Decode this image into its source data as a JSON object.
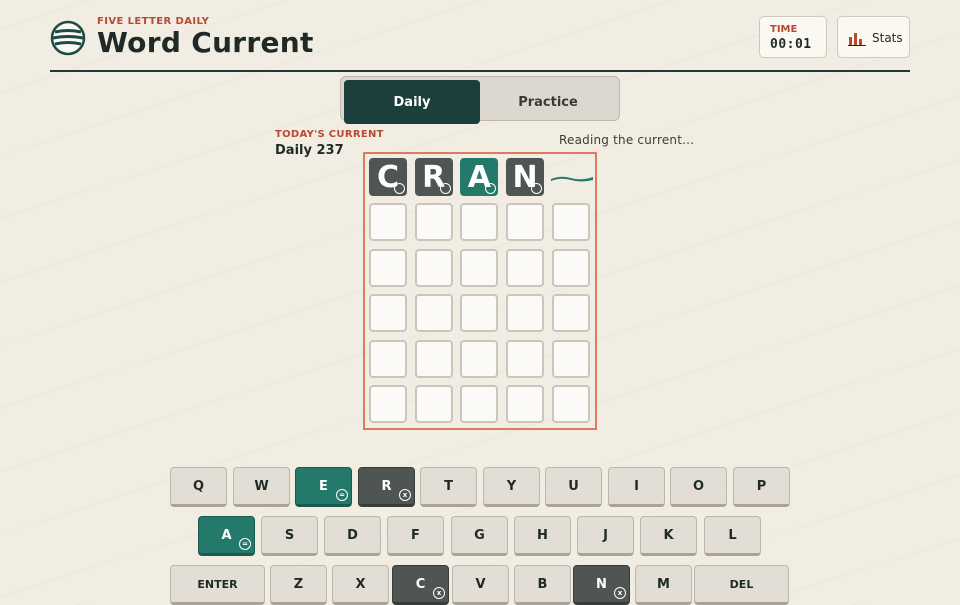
{
  "header": {
    "kicker": "FIVE LETTER DAILY",
    "title": "Word Current",
    "logo_icon": "wave-logo-icon",
    "timer_label": "TIME",
    "timer_value": "00:01",
    "stats_label": "Stats",
    "stats_icon": "bar-chart-icon"
  },
  "mode": {
    "daily": "Daily",
    "practice": "Practice",
    "selected": "Daily"
  },
  "puzzle": {
    "kicker": "TODAY'S CURRENT",
    "name": "Daily 237"
  },
  "status": "Reading the current...",
  "board": {
    "rows": [
      [
        {
          "letter": "C",
          "state": "absent"
        },
        {
          "letter": "R",
          "state": "absent"
        },
        {
          "letter": "A",
          "state": "present"
        },
        {
          "letter": "N",
          "state": "absent"
        },
        {
          "letter": "",
          "state": "typing"
        }
      ],
      [
        {
          "letter": "",
          "state": "empty"
        },
        {
          "letter": "",
          "state": "empty"
        },
        {
          "letter": "",
          "state": "empty"
        },
        {
          "letter": "",
          "state": "empty"
        },
        {
          "letter": "",
          "state": "empty"
        }
      ],
      [
        {
          "letter": "",
          "state": "empty"
        },
        {
          "letter": "",
          "state": "empty"
        },
        {
          "letter": "",
          "state": "empty"
        },
        {
          "letter": "",
          "state": "empty"
        },
        {
          "letter": "",
          "state": "empty"
        }
      ],
      [
        {
          "letter": "",
          "state": "empty"
        },
        {
          "letter": "",
          "state": "empty"
        },
        {
          "letter": "",
          "state": "empty"
        },
        {
          "letter": "",
          "state": "empty"
        },
        {
          "letter": "",
          "state": "empty"
        }
      ],
      [
        {
          "letter": "",
          "state": "empty"
        },
        {
          "letter": "",
          "state": "empty"
        },
        {
          "letter": "",
          "state": "empty"
        },
        {
          "letter": "",
          "state": "empty"
        },
        {
          "letter": "",
          "state": "empty"
        }
      ],
      [
        {
          "letter": "",
          "state": "empty"
        },
        {
          "letter": "",
          "state": "empty"
        },
        {
          "letter": "",
          "state": "empty"
        },
        {
          "letter": "",
          "state": "empty"
        },
        {
          "letter": "",
          "state": "empty"
        }
      ]
    ]
  },
  "keyboard": {
    "rows": [
      [
        {
          "label": "Q",
          "state": "default"
        },
        {
          "label": "W",
          "state": "default"
        },
        {
          "label": "E",
          "state": "present",
          "mark": "="
        },
        {
          "label": "R",
          "state": "absent",
          "mark": "x"
        },
        {
          "label": "T",
          "state": "default"
        },
        {
          "label": "Y",
          "state": "default"
        },
        {
          "label": "U",
          "state": "default"
        },
        {
          "label": "I",
          "state": "default"
        },
        {
          "label": "O",
          "state": "default"
        },
        {
          "label": "P",
          "state": "default"
        }
      ],
      [
        {
          "label": "A",
          "state": "present",
          "mark": "="
        },
        {
          "label": "S",
          "state": "default"
        },
        {
          "label": "D",
          "state": "default"
        },
        {
          "label": "F",
          "state": "default"
        },
        {
          "label": "G",
          "state": "default"
        },
        {
          "label": "H",
          "state": "default"
        },
        {
          "label": "J",
          "state": "default"
        },
        {
          "label": "K",
          "state": "default"
        },
        {
          "label": "L",
          "state": "default"
        }
      ],
      [
        {
          "label": "ENTER",
          "state": "default",
          "wide": true
        },
        {
          "label": "Z",
          "state": "default"
        },
        {
          "label": "X",
          "state": "default"
        },
        {
          "label": "C",
          "state": "absent",
          "mark": "x"
        },
        {
          "label": "V",
          "state": "default"
        },
        {
          "label": "B",
          "state": "default"
        },
        {
          "label": "N",
          "state": "absent",
          "mark": "x"
        },
        {
          "label": "M",
          "state": "default"
        },
        {
          "label": "DEL",
          "state": "default",
          "wide": true
        }
      ]
    ]
  },
  "colors": {
    "present": "#247a6a",
    "absent": "#4f5552",
    "accent": "#b74a33",
    "board_border": "#e07a5f",
    "nav_active": "#1b403b"
  }
}
